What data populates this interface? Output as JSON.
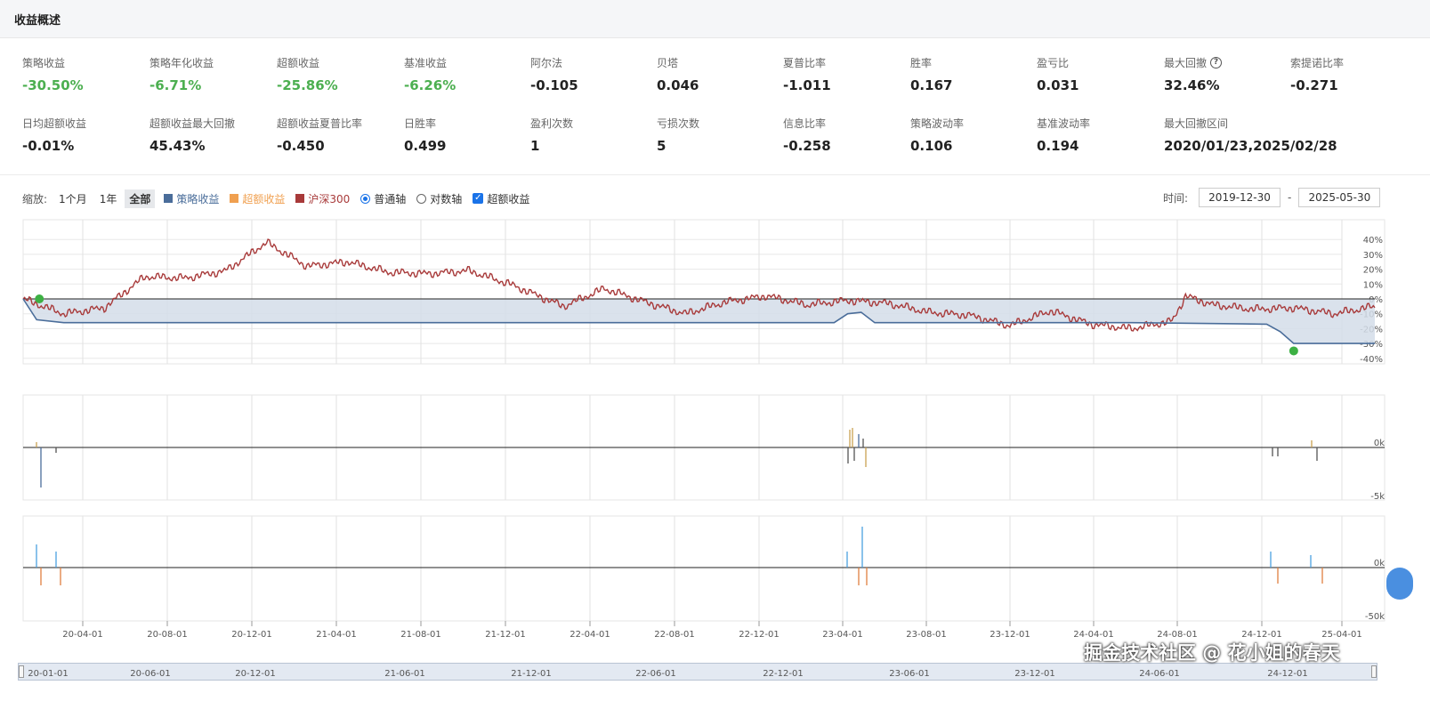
{
  "header": {
    "title": "收益概述"
  },
  "metrics_row1": [
    {
      "label": "策略收益",
      "value": "-30.50%",
      "color": "green"
    },
    {
      "label": "策略年化收益",
      "value": "-6.71%",
      "color": "green"
    },
    {
      "label": "超额收益",
      "value": "-25.86%",
      "color": "green"
    },
    {
      "label": "基准收益",
      "value": "-6.26%",
      "color": "green"
    },
    {
      "label": "阿尔法",
      "value": "-0.105",
      "color": "black"
    },
    {
      "label": "贝塔",
      "value": "0.046",
      "color": "black"
    },
    {
      "label": "夏普比率",
      "value": "-1.011",
      "color": "black"
    },
    {
      "label": "胜率",
      "value": "0.167",
      "color": "black"
    },
    {
      "label": "盈亏比",
      "value": "0.031",
      "color": "black"
    },
    {
      "label": "最大回撤",
      "value": "32.46%",
      "color": "black",
      "help": "?"
    },
    {
      "label": "索提诺比率",
      "value": "-0.271",
      "color": "black"
    }
  ],
  "metrics_row2": [
    {
      "label": "日均超额收益",
      "value": "-0.01%"
    },
    {
      "label": "超额收益最大回撤",
      "value": "45.43%"
    },
    {
      "label": "超额收益夏普比率",
      "value": "-0.450"
    },
    {
      "label": "日胜率",
      "value": "0.499"
    },
    {
      "label": "盈利次数",
      "value": "1"
    },
    {
      "label": "亏损次数",
      "value": "5"
    },
    {
      "label": "信息比率",
      "value": "-0.258"
    },
    {
      "label": "策略波动率",
      "value": "0.106"
    },
    {
      "label": "基准波动率",
      "value": "0.194"
    },
    {
      "label": "最大回撤区间",
      "value": "2020/01/23,2025/02/28"
    }
  ],
  "toolbar": {
    "zoom_label": "缩放:",
    "zoom_buttons": [
      "1个月",
      "1年",
      "全部"
    ],
    "active_zoom": "全部",
    "legend": [
      {
        "label": "策略收益",
        "color": "#4a6d9a"
      },
      {
        "label": "超额收益",
        "color": "#f0a050"
      },
      {
        "label": "沪深300",
        "color": "#a83a3a"
      }
    ],
    "axis_normal": "普通轴",
    "axis_log": "对数轴",
    "excess_checkbox": "超额收益"
  },
  "time_range": {
    "label": "时间:",
    "start": "2019-12-30",
    "separator": "-",
    "end": "2025-05-30"
  },
  "chart_data": {
    "type": "line",
    "main_y_ticks": [
      "40%",
      "30%",
      "20%",
      "10%",
      "0%",
      "-10%",
      "-20%",
      "-30%",
      "-40%"
    ],
    "ylim": [
      -40,
      40
    ],
    "x_ticks": [
      "20-04-01",
      "20-08-01",
      "20-12-01",
      "21-04-01",
      "21-08-01",
      "21-12-01",
      "22-04-01",
      "22-08-01",
      "22-12-01",
      "23-04-01",
      "23-08-01",
      "23-12-01",
      "24-04-01",
      "24-08-01",
      "24-12-01",
      "25-04-01"
    ],
    "navigator_ticks": [
      "20-01-01",
      "20-06-01",
      "20-12-01",
      "21-06-01",
      "21-12-01",
      "22-06-01",
      "22-12-01",
      "23-06-01",
      "23-12-01",
      "24-06-01",
      "24-12-01"
    ],
    "series": [
      {
        "name": "沪深300",
        "color": "#a83a3a",
        "x": [
          0,
          0.03,
          0.06,
          0.09,
          0.12,
          0.15,
          0.18,
          0.21,
          0.24,
          0.27,
          0.3,
          0.33,
          0.36,
          0.4,
          0.43,
          0.46,
          0.49,
          0.52,
          0.55,
          0.58,
          0.61,
          0.64,
          0.67,
          0.7,
          0.73,
          0.76,
          0.79,
          0.82,
          0.85,
          0.86,
          0.88,
          0.91,
          0.94,
          0.97,
          1.0
        ],
        "values": [
          0,
          -10,
          -6,
          15,
          14,
          19,
          38,
          22,
          25,
          18,
          17,
          19,
          10,
          -5,
          7,
          -2,
          -10,
          -2,
          2,
          -4,
          -1,
          -3,
          -9,
          -11,
          -18,
          -8,
          -17,
          -20,
          -15,
          2,
          -4,
          -7,
          -6,
          -10,
          -5
        ]
      },
      {
        "name": "策略收益",
        "color": "#4a6d9a",
        "x": [
          0,
          0.01,
          0.03,
          0.6,
          0.61,
          0.62,
          0.63,
          0.82,
          0.92,
          0.93,
          0.94,
          1.0
        ],
        "values": [
          0,
          -14,
          -16,
          -16,
          -10,
          -9,
          -16,
          -16,
          -17,
          -22,
          -30,
          -30
        ]
      }
    ],
    "sub1_y_ticks": [
      "0k",
      "-5k"
    ],
    "sub2_y_ticks": [
      "0k",
      "-50k"
    ]
  },
  "watermark": "掘金技术社区 @ 花小姐的春天"
}
